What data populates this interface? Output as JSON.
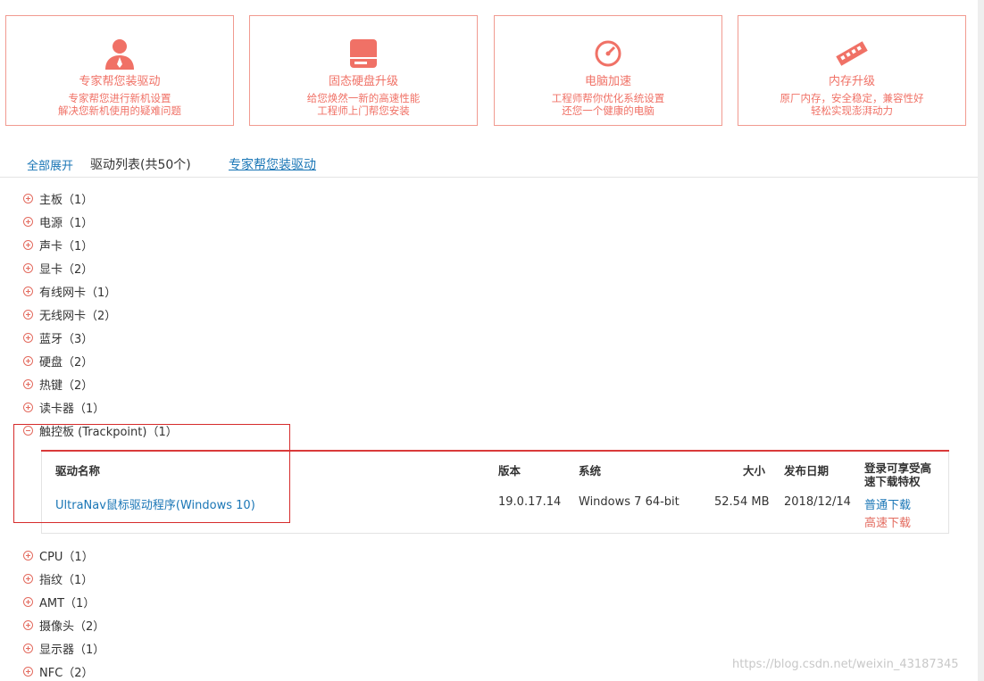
{
  "cards": [
    {
      "icon": "person-icon",
      "title": "专家帮您装驱动",
      "line1": "专家帮您进行新机设置",
      "line2": "解决您新机使用的疑难问题"
    },
    {
      "icon": "hard-drive-icon",
      "title": "固态硬盘升级",
      "line1": "给您焕然一新的高速性能",
      "line2": "工程师上门帮您安装"
    },
    {
      "icon": "speedometer-icon",
      "title": "电脑加速",
      "line1": "工程师帮你优化系统设置",
      "line2": "还您一个健康的电脑"
    },
    {
      "icon": "memory-stick-icon",
      "title": "内存升级",
      "line1": "原厂内存，安全稳定，兼容性好",
      "line2": "轻松实现澎湃动力"
    }
  ],
  "header": {
    "expand_all": "全部展开",
    "count": "驱动列表(共50个)",
    "expert_link": "专家帮您装驱动"
  },
  "categories_before": [
    {
      "label": "主板（1）"
    },
    {
      "label": "电源（1）"
    },
    {
      "label": "声卡（1）"
    },
    {
      "label": "显卡（2）"
    },
    {
      "label": "有线网卡（1）"
    },
    {
      "label": "无线网卡（2）"
    },
    {
      "label": "蓝牙（3）"
    },
    {
      "label": "硬盘（2）"
    },
    {
      "label": "热键（2）"
    },
    {
      "label": "读卡器（1）"
    }
  ],
  "expanded_category": {
    "label": "触控板 (Trackpoint)（1）"
  },
  "table": {
    "headers": {
      "name": "驱动名称",
      "version": "版本",
      "system": "系统",
      "size": "大小",
      "date": "发布日期",
      "download": "登录可享受高速下载特权"
    },
    "rows": [
      {
        "name": "UltraNav鼠标驱动程序(Windows 10)",
        "version": "19.0.17.14",
        "system": "Windows 7 64-bit",
        "size": "52.54 MB",
        "date": "2018/12/14",
        "normal_download": "普通下载",
        "fast_download": "高速下载"
      }
    ]
  },
  "categories_after": [
    {
      "label": "CPU（1）"
    },
    {
      "label": "指纹（1）"
    },
    {
      "label": "AMT（1）"
    },
    {
      "label": "摄像头（2）"
    },
    {
      "label": "显示器（1）"
    },
    {
      "label": "NFC（2）"
    }
  ],
  "watermark": "https://blog.csdn.net/weixin_43187345",
  "colors": {
    "accent_red": "#f07166",
    "link_blue": "#1a76b6",
    "table_top_red": "#d93a3a"
  }
}
